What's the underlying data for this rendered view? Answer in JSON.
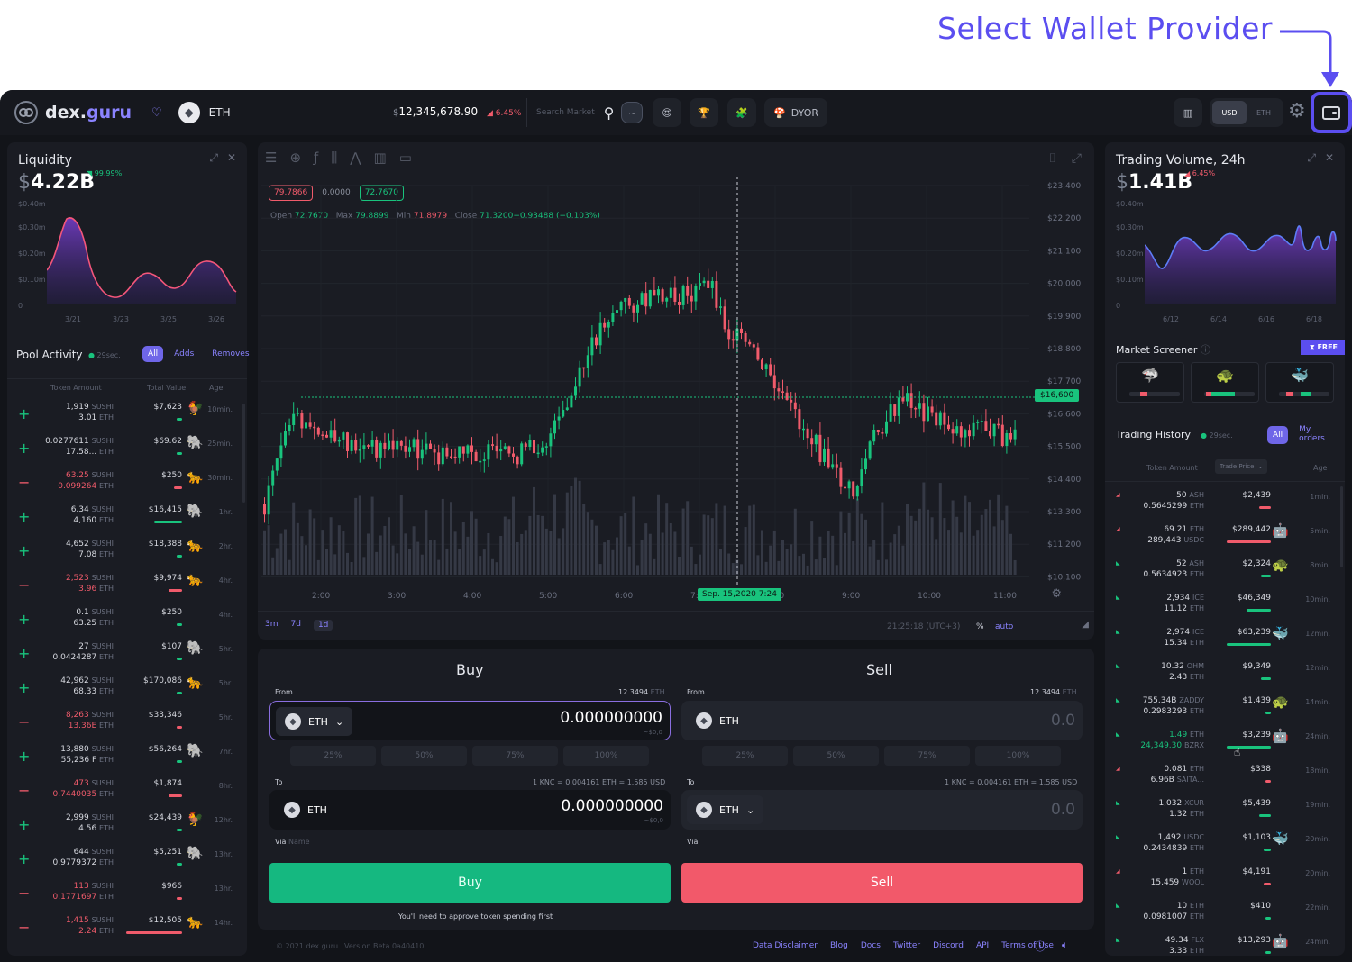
{
  "callout": {
    "text": "Select Wallet Provider"
  },
  "header": {
    "logo_text_1": "dex.",
    "logo_text_2": "guru",
    "network": "ETH",
    "price": "12,345,678.90",
    "price_prefix": "$",
    "price_change": "6.45%",
    "search_placeholder": "Search Market",
    "dyor": "DYOR",
    "currency_usd": "USD",
    "currency_eth": "ETH"
  },
  "liquidity": {
    "title": "Liquidity",
    "currency": "$",
    "value": "4.22B",
    "change": "99.99%",
    "y_top": "$0.40m",
    "y_labels": [
      "$0.30m",
      "$0.20m",
      "$0.10m",
      "0"
    ],
    "x_labels": [
      "3/21",
      "3/23",
      "3/25",
      "3/26"
    ]
  },
  "pool": {
    "title": "Pool Activity",
    "refresh": "29sec.",
    "filters": [
      "All",
      "Adds",
      "Removes"
    ],
    "headers": [
      "Token Amount",
      "Total Value",
      "Age"
    ],
    "rows": [
      {
        "sign": "+",
        "a1": "1,919",
        "u1": "SUSHI",
        "a2": "3.01",
        "u2": "ETH",
        "value": "$7,623",
        "animal": "🐓",
        "age": "10min.",
        "type": "add",
        "bar": 0.1
      },
      {
        "sign": "+",
        "a1": "0.0277611",
        "u1": "SUSHI",
        "a2": "17.58...",
        "u2": "ETH",
        "value": "$69.62",
        "animal": "🐘",
        "age": "25min.",
        "type": "add",
        "bar": 0.05
      },
      {
        "sign": "−",
        "a1": "63.25",
        "u1": "SUSHI",
        "a2": "0.099264",
        "u2": "ETH",
        "value": "$250",
        "animal": "🐆",
        "age": "30min.",
        "type": "remove",
        "bar": 0.15
      },
      {
        "sign": "+",
        "a1": "6.34",
        "u1": "SUSHI",
        "a2": "4,160",
        "u2": "ETH",
        "value": "$16,415",
        "animal": "🐘",
        "age": "1hr.",
        "type": "add",
        "bar": 0.5
      },
      {
        "sign": "+",
        "a1": "4,652",
        "u1": "SUSHI",
        "a2": "7.08",
        "u2": "ETH",
        "value": "$18,388",
        "animal": "🐆",
        "age": "2hr.",
        "type": "add",
        "bar": 0.1
      },
      {
        "sign": "−",
        "a1": "2,523",
        "u1": "SUSHI",
        "a2": "3.96",
        "u2": "ETH",
        "value": "$9,974",
        "animal": "🐆",
        "age": "4hr.",
        "type": "remove",
        "bar": 0.25
      },
      {
        "sign": "+",
        "a1": "0.1",
        "u1": "SUSHI",
        "a2": "63.25",
        "u2": "ETH",
        "value": "$250",
        "animal": "",
        "age": "4hr.",
        "type": "add",
        "bar": 0.05
      },
      {
        "sign": "+",
        "a1": "27",
        "u1": "SUSHI",
        "a2": "0.0424287",
        "u2": "ETH",
        "value": "$107",
        "animal": "🐘",
        "age": "5hr.",
        "type": "add",
        "bar": 0.05
      },
      {
        "sign": "+",
        "a1": "42,962",
        "u1": "SUSHI",
        "a2": "68.33",
        "u2": "ETH",
        "value": "$170,086",
        "animal": "🐆",
        "age": "5hr.",
        "type": "add",
        "bar": 0.05
      },
      {
        "sign": "−",
        "a1": "8,263",
        "u1": "SUSHI",
        "a2": "13.36E",
        "u2": "ETH",
        "value": "$33,346",
        "animal": "",
        "age": "5hr.",
        "type": "remove",
        "bar": 0.05
      },
      {
        "sign": "+",
        "a1": "13,880",
        "u1": "SUSHI",
        "a2": "55,236 F",
        "u2": "ETH",
        "value": "$56,264",
        "animal": "🐘",
        "age": "7hr.",
        "type": "add",
        "bar": 0.05
      },
      {
        "sign": "−",
        "a1": "473",
        "u1": "SUSHI",
        "a2": "0.7440035",
        "u2": "ETH",
        "value": "$1,874",
        "animal": "",
        "age": "8hr.",
        "type": "remove",
        "bar": 0.25
      },
      {
        "sign": "+",
        "a1": "2,999",
        "u1": "SUSHI",
        "a2": "4.56",
        "u2": "ETH",
        "value": "$24,439",
        "animal": "🐓",
        "age": "12hr.",
        "type": "add",
        "bar": 0.05
      },
      {
        "sign": "+",
        "a1": "644",
        "u1": "SUSHI",
        "a2": "0.9779372",
        "u2": "ETH",
        "value": "$5,251",
        "animal": "🐘",
        "age": "13hr.",
        "type": "add",
        "bar": 0.05
      },
      {
        "sign": "−",
        "a1": "113",
        "u1": "SUSHI",
        "a2": "0.1771697",
        "u2": "ETH",
        "value": "$966",
        "animal": "",
        "age": "13hr.",
        "type": "remove",
        "bar": 0.05
      },
      {
        "sign": "−",
        "a1": "1,415",
        "u1": "SUSHI",
        "a2": "2.24",
        "u2": "ETH",
        "value": "$12,505",
        "animal": "🐆",
        "age": "14hr.",
        "type": "remove",
        "bar": 1.0
      }
    ]
  },
  "chart_toolbar": {
    "ohlc_open_label": "Open",
    "ohlc_open": "72.7670",
    "ohlc_max_label": "Max",
    "ohlc_max": "79.8899",
    "ohlc_min_label": "Min",
    "ohlc_min": "71.8979",
    "ohlc_close_label": "Close",
    "ohlc_close": "71.3200−0.93488 (−0.103%)",
    "box_1": "79.7866",
    "box_mid": "0.0000",
    "box_2": "72.7670",
    "crosshair_price": "$16,600",
    "crosshair_date": "Sep. 15,2020 7:24",
    "time_ranges": [
      "3m",
      "7d",
      "1d"
    ],
    "clock": "21:25:18 (UTC+3)",
    "pct": "%",
    "auto": "auto"
  },
  "chart_data": {
    "type": "candlestick",
    "x_ticks": [
      "2:00",
      "3:00",
      "4:00",
      "5:00",
      "6:00",
      "7:00",
      "8:00",
      "9:00",
      "10:00",
      "11:00"
    ],
    "y_ticks": [
      "$23,400",
      "$22,200",
      "$21,100",
      "$20,000",
      "$19,900",
      "$18,800",
      "$17,700",
      "$16,600",
      "$15,500",
      "$14,400",
      "$13,300",
      "$11,200",
      "$10,100"
    ],
    "ylim": [
      10100,
      23400
    ]
  },
  "buy": {
    "title": "Buy",
    "from_label": "From",
    "balance": "12.3494",
    "balance_unit": "ETH",
    "from_token": "ETH",
    "from_amount": "0.000000000",
    "from_usd": "~$0,0",
    "pcts": [
      "25%",
      "50%",
      "75%",
      "100%"
    ],
    "to_label": "To",
    "rate": "1 KNC = 0.004161 ETH = 1.585 USD",
    "to_token": "ETH",
    "to_amount": "0.000000000",
    "to_usd": "~$0,0",
    "via_label": "Via",
    "via_value": "Name",
    "button": "Buy",
    "note": "You'll need to approve token spending first"
  },
  "sell": {
    "title": "Sell",
    "from_label": "From",
    "balance": "12.3494",
    "balance_unit": "ETH",
    "from_token": "ETH",
    "from_amount": "0.0",
    "pcts": [
      "25%",
      "50%",
      "75%",
      "100%"
    ],
    "to_label": "To",
    "rate": "1 KNC = 0.004161 ETH = 1.585 USD",
    "to_token": "ETH",
    "to_amount": "0.0",
    "via_label": "Via",
    "button": "Sell"
  },
  "footer": {
    "copyright": "© 2021 dex.guru",
    "version": "Version Beta 0a40410",
    "links": [
      "Data Disclaimer",
      "Blog",
      "Docs",
      "Twitter",
      "Discord",
      "API",
      "Terms of Use"
    ]
  },
  "volume": {
    "title": "Trading Volume, 24h",
    "currency": "$",
    "value": "1.41B",
    "change": "6.45%",
    "y_top": "$0.40m",
    "y_labels": [
      "$0.30m",
      "$0.20m",
      "$0.10m",
      "0"
    ],
    "x_labels": [
      "6/12",
      "6/14",
      "6/16",
      "6/18"
    ]
  },
  "screener": {
    "title": "Market Screener",
    "badge": "FREE",
    "cards": [
      "🦈",
      "🐢",
      "🐳"
    ]
  },
  "history": {
    "title": "Trading History",
    "refresh": "29sec.",
    "filters": [
      "All",
      "My orders"
    ],
    "headers": [
      "Token Amount",
      "Trade Price",
      "Age"
    ],
    "rows": [
      {
        "a1": "50",
        "u1": "ASH",
        "a2": "0.5645299",
        "u2": "ETH",
        "value": "$2,439",
        "animal": "",
        "age": "1min.",
        "type": "sell",
        "bar": 0.25
      },
      {
        "a1": "69.21",
        "u1": "ETH",
        "a2": "289,443",
        "u2": "USDC",
        "value": "$289,442",
        "animal": "🤖",
        "age": "5min.",
        "type": "sell",
        "bar": 0.9
      },
      {
        "a1": "52",
        "u1": "ASH",
        "a2": "0.5634923",
        "u2": "ETH",
        "value": "$2,324",
        "animal": "🐢",
        "age": "8min.",
        "type": "buy",
        "bar": 0.2
      },
      {
        "a1": "2,934",
        "u1": "ICE",
        "a2": "11.12",
        "u2": "ETH",
        "value": "$46,349",
        "animal": "",
        "age": "10min.",
        "type": "buy",
        "bar": 0.5
      },
      {
        "a1": "2,974",
        "u1": "ICE",
        "a2": "15.34",
        "u2": "ETH",
        "value": "$63,239",
        "animal": "🐳",
        "age": "12min.",
        "type": "buy",
        "bar": 0.9
      },
      {
        "a1": "10.32",
        "u1": "OHM",
        "a2": "2.43",
        "u2": "ETH",
        "value": "$9,349",
        "animal": "",
        "age": "12min.",
        "type": "buy",
        "bar": 0.2
      },
      {
        "a1": "755.34B",
        "u1": "ZADDY",
        "a2": "0.2983293",
        "u2": "ETH",
        "value": "$1,439",
        "animal": "🐢",
        "age": "14min.",
        "type": "buy",
        "bar": 0.05
      },
      {
        "a1": "1.49",
        "u1": "ETH",
        "a2": "24,349.30",
        "u2": "BZRX",
        "value": "$3,239",
        "animal": "🤖",
        "age": "24min.",
        "type": "buy",
        "bar": 0.9,
        "highlight": true
      },
      {
        "a1": "0.081",
        "u1": "ETH",
        "a2": "6.96B",
        "u2": "SAITA...",
        "value": "$338",
        "animal": "",
        "age": "18min.",
        "type": "sell",
        "bar": 0.05
      },
      {
        "a1": "1,032",
        "u1": "XCUR",
        "a2": "1.32",
        "u2": "ETH",
        "value": "$5,439",
        "animal": "",
        "age": "19min.",
        "type": "buy",
        "bar": 0.25
      },
      {
        "a1": "1,492",
        "u1": "USDC",
        "a2": "0.2434839",
        "u2": "ETH",
        "value": "$1,103",
        "animal": "🐳",
        "age": "20min.",
        "type": "buy",
        "bar": 0.15
      },
      {
        "a1": "1",
        "u1": "ETH",
        "a2": "15,459",
        "u2": "WOOL",
        "value": "$4,191",
        "animal": "",
        "age": "20min.",
        "type": "sell",
        "bar": 0.15
      },
      {
        "a1": "10",
        "u1": "ETH",
        "a2": "0.0981007",
        "u2": "ETH",
        "value": "$410",
        "animal": "",
        "age": "22min.",
        "type": "buy",
        "bar": 0.05
      },
      {
        "a1": "49.34",
        "u1": "FLX",
        "a2": "3.33",
        "u2": "ETH",
        "value": "$13,293",
        "animal": "🤖",
        "age": "24min.",
        "type": "buy",
        "bar": 0.05
      }
    ]
  },
  "colors": {
    "accent": "#5b4ef0",
    "green": "#19c37d",
    "red": "#f05b6b",
    "bg": "#121419",
    "panel": "#1a1c23"
  }
}
